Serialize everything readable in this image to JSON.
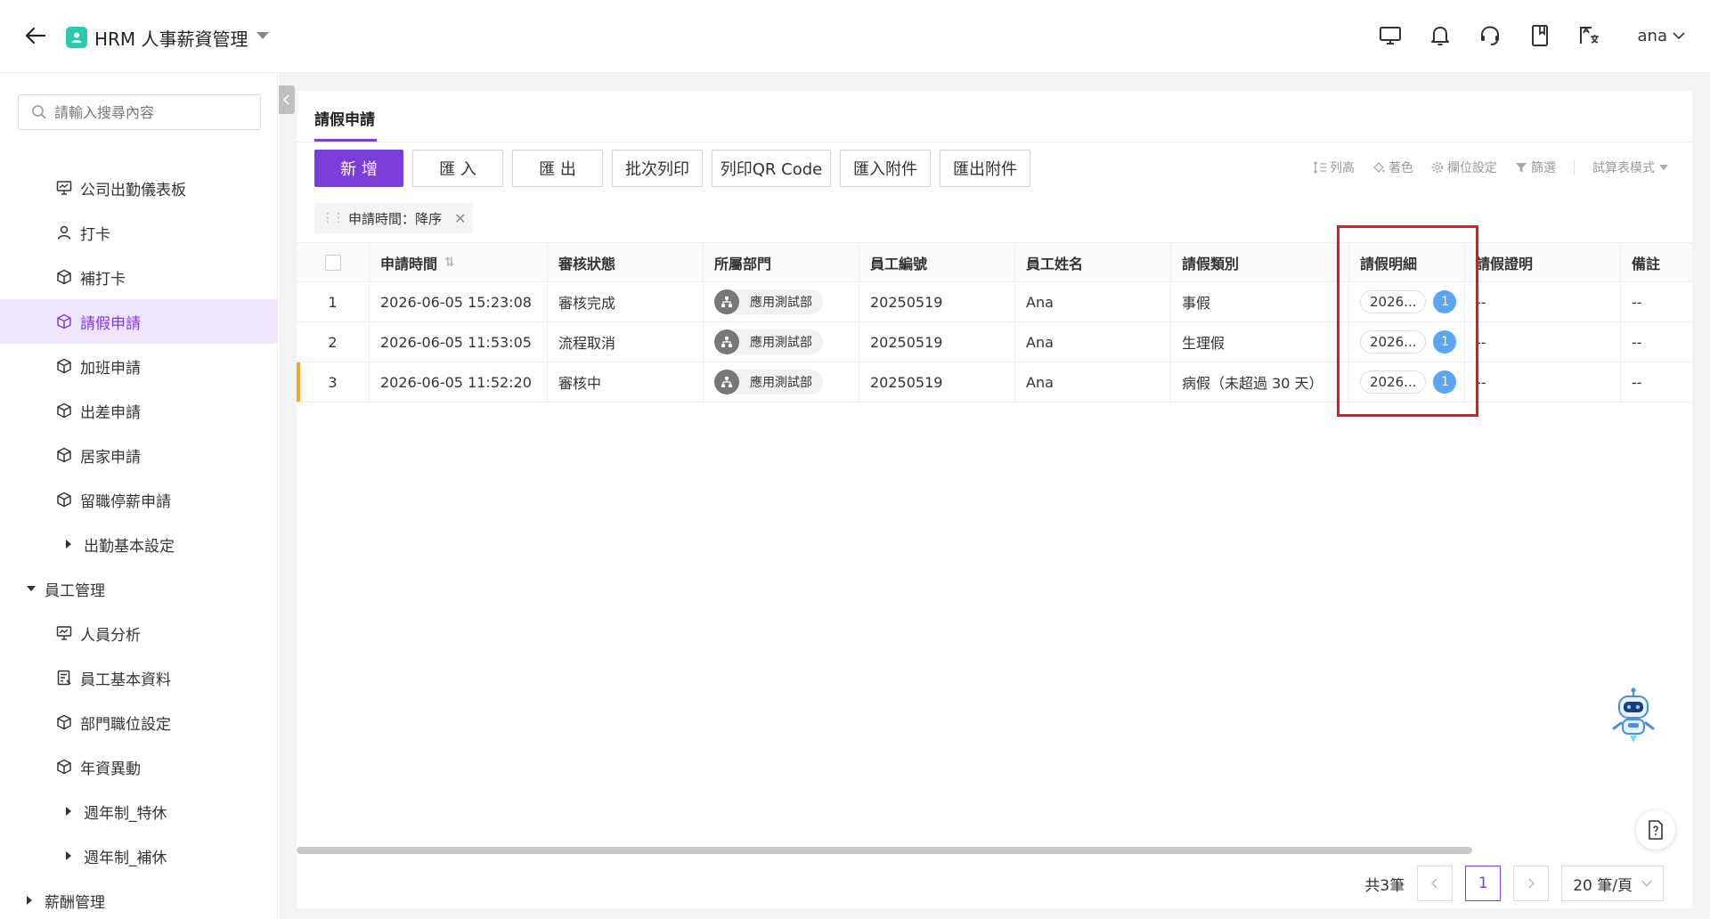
{
  "header": {
    "app_title": "HRM 人事薪資管理",
    "user": "ana"
  },
  "sidebar": {
    "search_placeholder": "請輸入搜尋內容",
    "items": [
      {
        "label": "公司出勤儀表板",
        "level": "sub",
        "icon": "dashboard-icon"
      },
      {
        "label": "打卡",
        "level": "sub",
        "icon": "user-icon"
      },
      {
        "label": "補打卡",
        "level": "sub",
        "icon": "cube-icon"
      },
      {
        "label": "請假申請",
        "level": "sub",
        "icon": "cube-icon",
        "active": true
      },
      {
        "label": "加班申請",
        "level": "sub",
        "icon": "cube-icon"
      },
      {
        "label": "出差申請",
        "level": "sub",
        "icon": "cube-icon"
      },
      {
        "label": "居家申請",
        "level": "sub",
        "icon": "cube-icon"
      },
      {
        "label": "留職停薪申請",
        "level": "sub",
        "icon": "cube-icon"
      },
      {
        "label": "出勤基本設定",
        "level": "subgroup",
        "icon": "caret-right-icon"
      },
      {
        "label": "員工管理",
        "level": "group",
        "icon": "caret-down-icon"
      },
      {
        "label": "人員分析",
        "level": "sub",
        "icon": "dashboard-icon"
      },
      {
        "label": "員工基本資料",
        "level": "sub",
        "icon": "form-icon"
      },
      {
        "label": "部門職位設定",
        "level": "sub",
        "icon": "cube-icon"
      },
      {
        "label": "年資異動",
        "level": "sub",
        "icon": "cube-icon"
      },
      {
        "label": "週年制_特休",
        "level": "subgroup",
        "icon": "caret-right-icon"
      },
      {
        "label": "週年制_補休",
        "level": "subgroup",
        "icon": "caret-right-icon"
      },
      {
        "label": "薪酬管理",
        "level": "group",
        "icon": "caret-right-icon"
      }
    ]
  },
  "page": {
    "tab_title": "請假申請"
  },
  "toolbar": {
    "buttons": [
      "新 增",
      "匯 入",
      "匯 出",
      "批次列印",
      "列印QR Code",
      "匯入附件",
      "匯出附件"
    ],
    "right_tools": [
      "列高",
      "著色",
      "欄位設定",
      "篩選",
      "試算表模式"
    ]
  },
  "sort_tag": "申請時間：降序",
  "table": {
    "columns": [
      "申請時間",
      "審核狀態",
      "所屬部門",
      "員工編號",
      "員工姓名",
      "請假類別",
      "請假明細",
      "請假證明",
      "備註"
    ],
    "rows": [
      {
        "no": "1",
        "time": "2026-06-05 15:23:08",
        "status": "審核完成",
        "dept": "應用測試部",
        "emp_id": "20250519",
        "name": "Ana",
        "type": "事假",
        "detail": "2026...",
        "count": "1",
        "proof": "--",
        "note": "--",
        "marked": false
      },
      {
        "no": "2",
        "time": "2026-06-05 11:53:05",
        "status": "流程取消",
        "dept": "應用測試部",
        "emp_id": "20250519",
        "name": "Ana",
        "type": "生理假",
        "detail": "2026...",
        "count": "1",
        "proof": "--",
        "note": "--",
        "marked": false
      },
      {
        "no": "3",
        "time": "2026-06-05 11:52:20",
        "status": "審核中",
        "dept": "應用測試部",
        "emp_id": "20250519",
        "name": "Ana",
        "type": "病假（未超過 30 天）",
        "detail": "2026...",
        "count": "1",
        "proof": "--",
        "note": "--",
        "marked": true
      }
    ]
  },
  "pager": {
    "total": "共3筆",
    "current_page": "1",
    "page_size": "20 筆/頁"
  },
  "colors": {
    "accent": "#7c3ed9",
    "active_bg": "#efe6fb",
    "badge_blue": "#5aa6f5",
    "highlight_red": "#e0191f",
    "row_marker": "#f5a623"
  }
}
